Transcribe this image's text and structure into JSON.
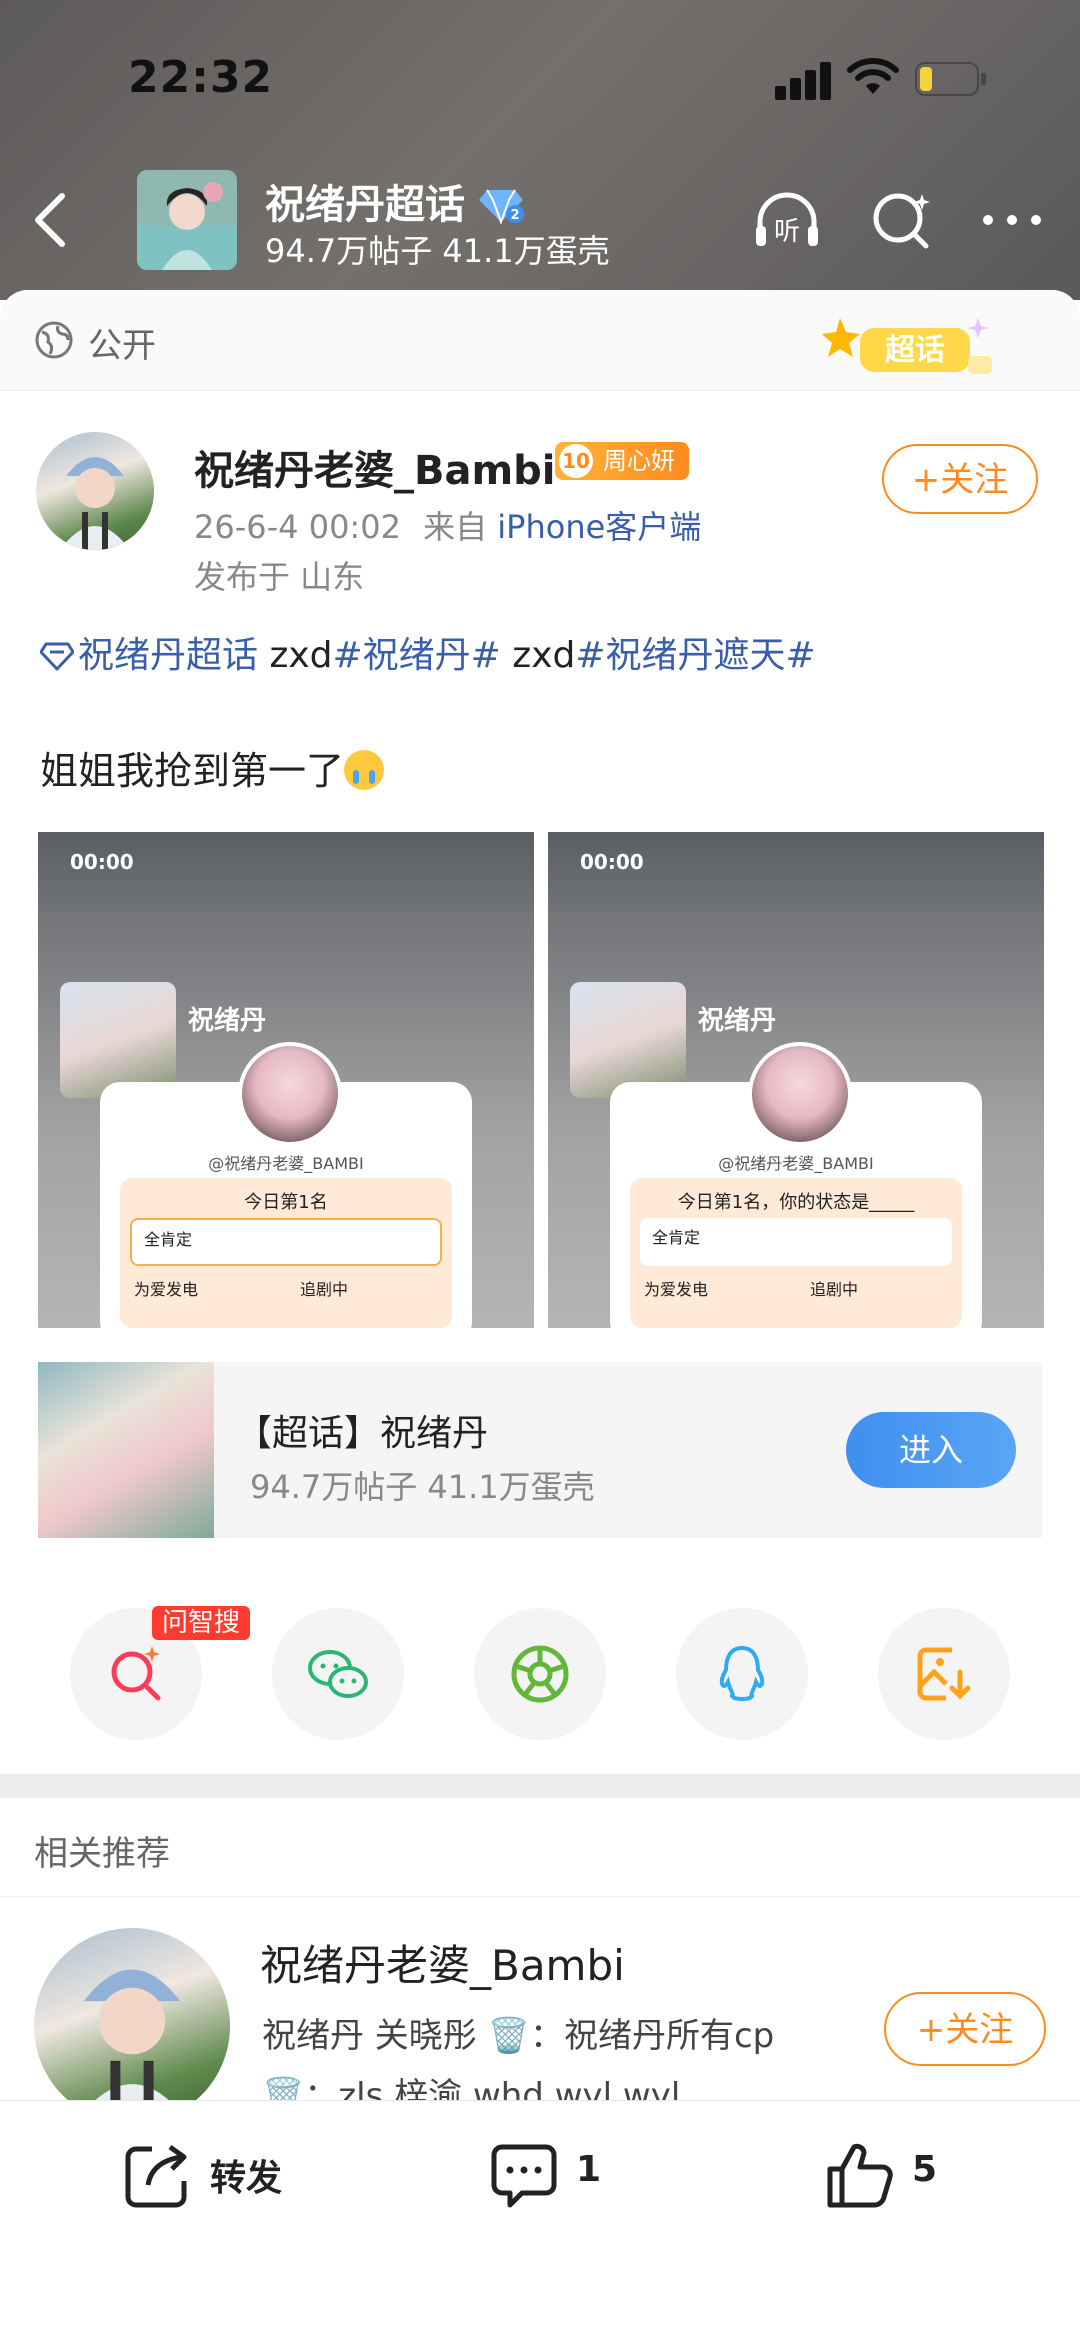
{
  "status_bar": {
    "time": "22:32"
  },
  "header": {
    "title": "祝绪丹超话",
    "subtitle": "94.7万帖子 41.1万蛋壳"
  },
  "visibility": {
    "label": "公开",
    "sticker": "超话"
  },
  "post": {
    "author": "祝绪丹老婆_Bambi",
    "badge_level": "10",
    "badge_text": "周心妍",
    "time": "26-6-4 00:02",
    "source_prefix": "来自",
    "source": "iPhone客户端",
    "location": "发布于 山东",
    "follow_label": "+关注",
    "tags": {
      "supertopic": "祝绪丹超话",
      "plain1": " zxd",
      "tag1": "#祝绪丹#",
      "plain2": " zxd",
      "tag2": "#祝绪丹遮天#"
    },
    "text": "姐姐我抢到第一了"
  },
  "screenshots": [
    {
      "time": "00:00",
      "name": "祝绪丹",
      "handle": "@祝绪丹老婆_BAMBI",
      "question": "今日第1名",
      "option": "全肯定",
      "row_left": "为爱发电",
      "row_right": "追剧中"
    },
    {
      "time": "00:00",
      "name": "祝绪丹",
      "handle": "@祝绪丹老婆_BAMBI",
      "question": "今日第1名，你的状态是_____",
      "option": "全肯定",
      "row_left": "为爱发电",
      "row_right": "追剧中"
    }
  ],
  "supertopic_card": {
    "title": "【超话】祝绪丹",
    "subtitle": "94.7万帖子 41.1万蛋壳",
    "enter_label": "进入"
  },
  "share": {
    "ai_badge": "问智搜",
    "items": [
      "search-ai-icon",
      "wechat-icon",
      "moments-icon",
      "qq-icon",
      "save-image-icon"
    ]
  },
  "recommend": {
    "title": "相关推荐",
    "name": "祝绪丹老婆_Bambi",
    "desc": "祝绪丹  关晓彤 🗑️：祝绪丹所有cp 🗑️：zls 梓渝 whd wyl wyl",
    "follow_label": "+关注"
  },
  "bottom_bar": {
    "repost_label": "转发",
    "comment_count": "1",
    "like_count": "5"
  },
  "colors": {
    "accent": "#ff8a1e",
    "link": "#3b5ea8",
    "enter": "#3f8ff0"
  }
}
